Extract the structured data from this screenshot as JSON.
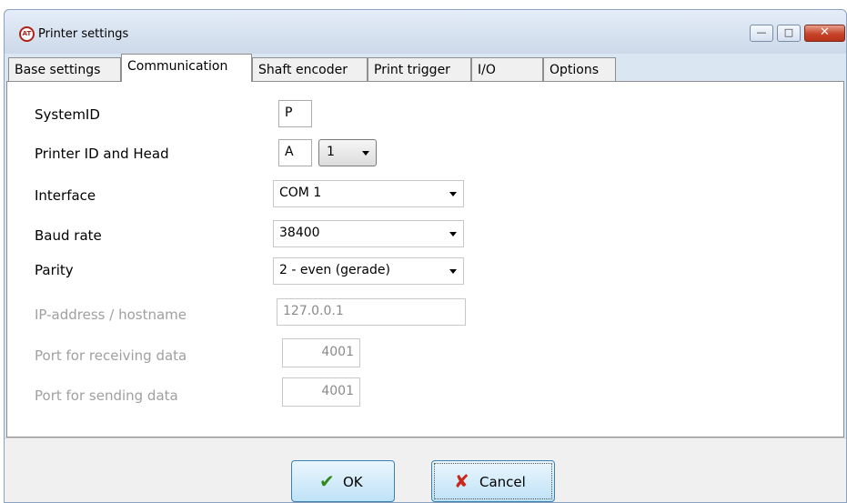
{
  "window": {
    "title": "Printer settings",
    "controls": {
      "minimize_icon": "minimize-icon",
      "maximize_icon": "maximize-icon",
      "close_icon": "close-icon"
    }
  },
  "tabs": [
    {
      "label": "Base settings",
      "active": false
    },
    {
      "label": "Communication",
      "active": true
    },
    {
      "label": "Shaft encoder",
      "active": false
    },
    {
      "label": "Print trigger",
      "active": false
    },
    {
      "label": "I/O",
      "active": false
    },
    {
      "label": "Options",
      "active": false
    }
  ],
  "form": {
    "system_id": {
      "label": "SystemID",
      "value": "P"
    },
    "printer_id_head": {
      "label": "Printer ID and Head",
      "printer_id": "A",
      "head": "1"
    },
    "interface": {
      "label": "Interface",
      "value": "COM 1"
    },
    "baud_rate": {
      "label": "Baud rate",
      "value": "38400"
    },
    "parity": {
      "label": "Parity",
      "value": "2 - even (gerade)"
    },
    "ip_address": {
      "label": "IP-address / hostname",
      "value": "127.0.0.1"
    },
    "port_receive": {
      "label": "Port for receiving data",
      "value": "4001"
    },
    "port_send": {
      "label": "Port for sending data",
      "value": "4001"
    }
  },
  "footer": {
    "ok_label": "OK",
    "cancel_label": "Cancel"
  },
  "colors": {
    "disabled_text": "#a0a0a0",
    "ok_check": "#2f8a1c",
    "cancel_x": "#c8281e"
  }
}
